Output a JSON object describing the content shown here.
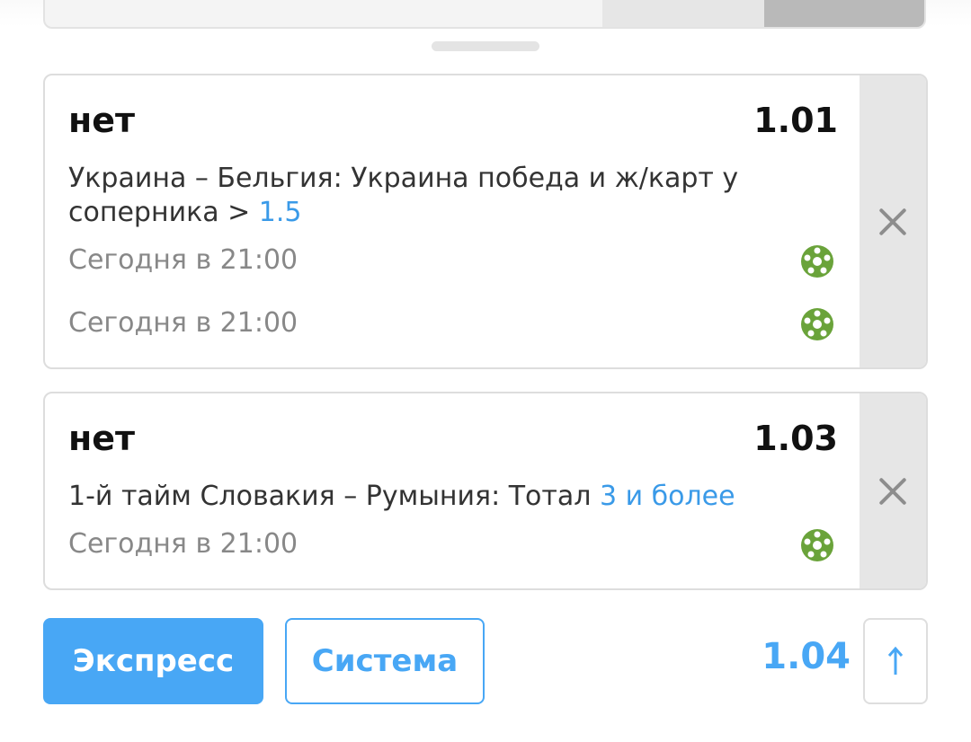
{
  "bets": [
    {
      "name": "нет",
      "odds": "1.01",
      "event_prefix": "Украина – Бельгия: Украина победа и ж/карт у соперника > ",
      "event_highlight": "1.5",
      "times": [
        "Сегодня в 21:00",
        "Сегодня в 21:00"
      ],
      "sport_icon": "soccer-ball-icon"
    },
    {
      "name": "нет",
      "odds": "1.03",
      "event_prefix": "1-й тайм Словакия – Румыния: Тотал ",
      "event_highlight": "3 и более",
      "times": [
        "Сегодня в 21:00"
      ],
      "sport_icon": "soccer-ball-icon"
    }
  ],
  "footer": {
    "express_label": "Экспресс",
    "system_label": "Система",
    "total_odds": "1.04",
    "up_arrow": "↑"
  },
  "colors": {
    "accent": "#48a7f5",
    "link": "#3a9ae8",
    "ball_green": "#6aa33a"
  }
}
